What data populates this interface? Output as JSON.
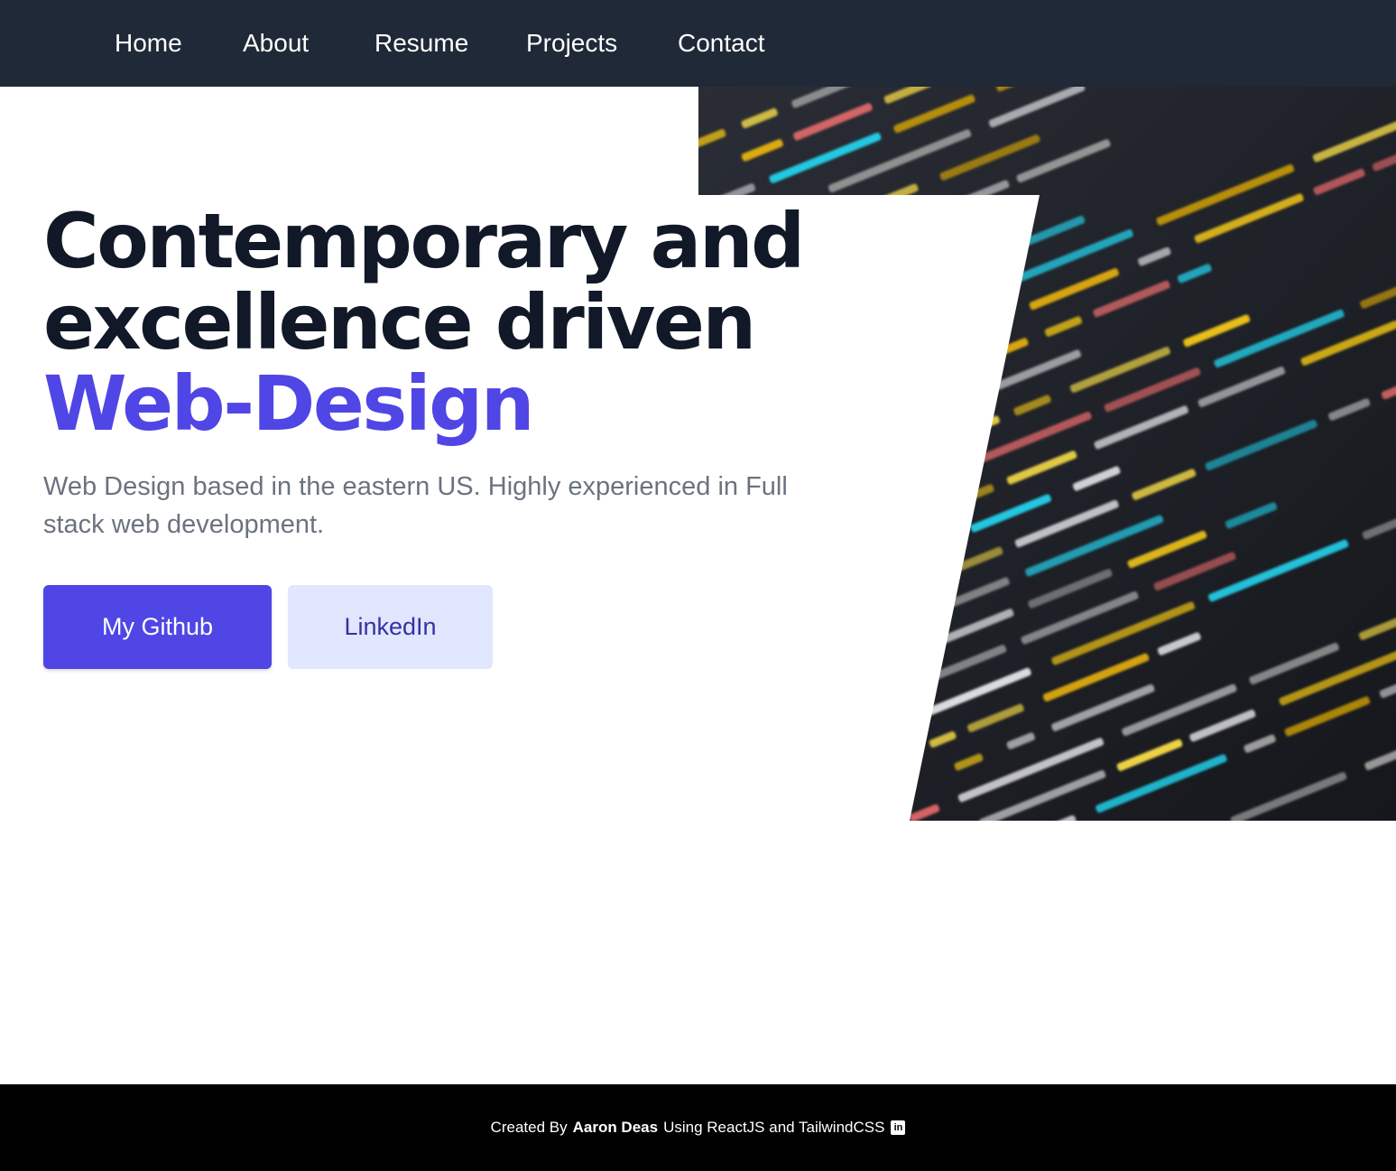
{
  "nav": {
    "items": [
      {
        "label": "Home"
      },
      {
        "label": "About"
      },
      {
        "label": "Resume"
      },
      {
        "label": "Projects"
      },
      {
        "label": "Contact"
      }
    ]
  },
  "hero": {
    "headline_line1": "Contemporary and",
    "headline_line2": "excellence driven",
    "headline_accent": "Web-Design",
    "subtitle": "Web Design based in the eastern US. Highly experienced in Full stack web development.",
    "primary_button": "My Github",
    "secondary_button": "LinkedIn",
    "image_icon": "code-screenshot-image"
  },
  "footer": {
    "prefix": "Created By",
    "author": "Aaron Deas",
    "suffix": "Using ReactJS and TailwindCSS",
    "icon": "linkedin-icon"
  },
  "colors": {
    "nav_bg": "#1f2937",
    "accent": "#4f46e5",
    "headline": "#111827",
    "subtitle": "#6b7280",
    "secondary_btn_bg": "#e0e7ff",
    "secondary_btn_text": "#3730a3",
    "footer_bg": "#000000"
  }
}
